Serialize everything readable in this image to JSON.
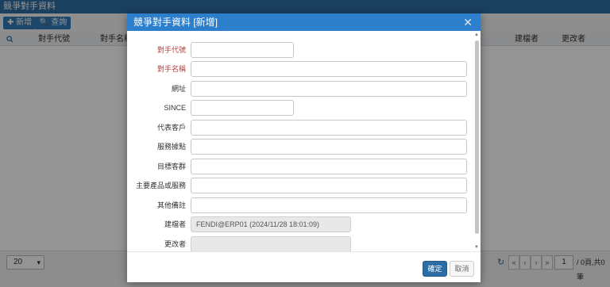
{
  "app": {
    "title": "競爭對手資料"
  },
  "toolbar": {
    "add_label": "✚ 新增",
    "query_label": "🔍 查詢"
  },
  "grid": {
    "headers": [
      "對手代號",
      "對手名稱",
      "建檔者",
      "更改者"
    ],
    "search_icon": "search-icon"
  },
  "pager": {
    "page_size": "20",
    "first": "«",
    "prev": "‹",
    "next": "›",
    "last": "»",
    "refresh_icon": "↻",
    "current_page": "1",
    "total": "/ 0頁,共0筆"
  },
  "modal": {
    "title": "競爭對手資料 [新增]",
    "close": "✕",
    "fields": {
      "code_label": "對手代號",
      "name_label": "對手名稱",
      "url_label": "網址",
      "since_label": "SINCE",
      "agent_label": "代表客戶",
      "service_label": "服務據點",
      "target_label": "目標客群",
      "product_label": "主要產品或服務",
      "note_label": "其他備註",
      "creator_label": "建檔者",
      "creator_value": "FENDI@ERP01 (2024/11/28 18:01:09)",
      "modifier_label": "更改者",
      "modifier_value": ""
    },
    "ok_label": "確定",
    "cancel_label": "取消"
  }
}
